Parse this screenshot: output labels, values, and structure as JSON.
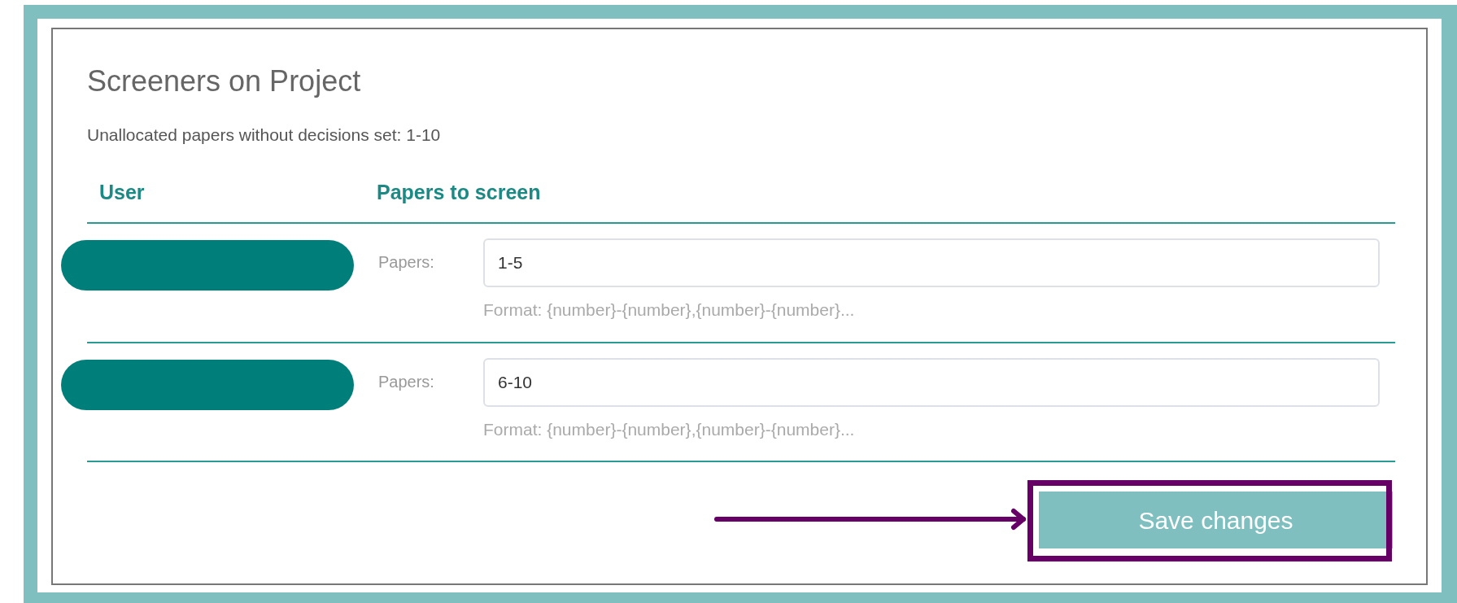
{
  "card": {
    "title": "Screeners on Project",
    "subtitle": "Unallocated papers without decisions set: 1-10",
    "columns": [
      "User",
      "Papers to screen"
    ],
    "rows": [
      {
        "user_redacted": true,
        "label": "Papers:",
        "value": "1-5",
        "hint": "Format: {number}-{number},{number}-{number}..."
      },
      {
        "user_redacted": true,
        "label": "Papers:",
        "value": "6-10",
        "hint": "Format: {number}-{number},{number}-{number}..."
      }
    ],
    "save_button": "Save changes"
  },
  "annotation": {
    "kind": "arrow-box"
  }
}
